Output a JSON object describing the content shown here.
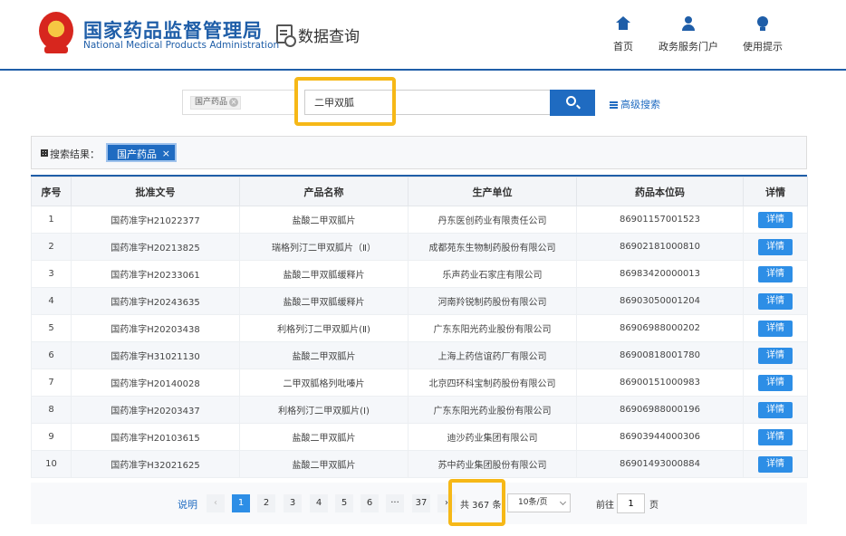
{
  "header": {
    "brand_cn": "国家药品监督管理局",
    "brand_en": "National Medical Products Administration",
    "query_title": "数据查询",
    "nav": [
      {
        "label": "首页",
        "icon": "home-icon"
      },
      {
        "label": "政务服务门户",
        "icon": "user-icon"
      },
      {
        "label": "使用提示",
        "icon": "lightbulb-icon"
      }
    ]
  },
  "search": {
    "scope_tag": "国产药品",
    "query": "二甲双胍",
    "advanced_label": "高级搜索"
  },
  "results": {
    "label": "搜索结果：",
    "chip": "国产药品",
    "chip_close": "×"
  },
  "table": {
    "headers": [
      "序号",
      "批准文号",
      "产品名称",
      "生产单位",
      "药品本位码",
      "详情"
    ],
    "detail_label": "详情",
    "rows": [
      [
        "1",
        "国药准字H21022377",
        "盐酸二甲双胍片",
        "丹东医创药业有限责任公司",
        "86901157001523"
      ],
      [
        "2",
        "国药准字H20213825",
        "瑞格列汀二甲双胍片（Ⅱ）",
        "成都苑东生物制药股份有限公司",
        "86902181000810"
      ],
      [
        "3",
        "国药准字H20233061",
        "盐酸二甲双胍缓释片",
        "乐声药业石家庄有限公司",
        "86983420000013"
      ],
      [
        "4",
        "国药准字H20243635",
        "盐酸二甲双胍缓释片",
        "河南羚锐制药股份有限公司",
        "86903050001204"
      ],
      [
        "5",
        "国药准字H20203438",
        "利格列汀二甲双胍片(Ⅱ)",
        "广东东阳光药业股份有限公司",
        "86906988000202"
      ],
      [
        "6",
        "国药准字H31021130",
        "盐酸二甲双胍片",
        "上海上药信谊药厂有限公司",
        "86900818001780"
      ],
      [
        "7",
        "国药准字H20140028",
        "二甲双胍格列吡嗪片",
        "北京四环科宝制药股份有限公司",
        "86900151000983"
      ],
      [
        "8",
        "国药准字H20203437",
        "利格列汀二甲双胍片(Ⅰ)",
        "广东东阳光药业股份有限公司",
        "86906988000196"
      ],
      [
        "9",
        "国药准字H20103615",
        "盐酸二甲双胍片",
        "迪沙药业集团有限公司",
        "86903944000306"
      ],
      [
        "10",
        "国药准字H32021625",
        "盐酸二甲双胍片",
        "苏中药业集团股份有限公司",
        "86901493000884"
      ]
    ]
  },
  "pagination": {
    "explain": "说明",
    "prev": "‹",
    "pages": [
      "1",
      "2",
      "3",
      "4",
      "5",
      "6",
      "···",
      "37"
    ],
    "next": "›",
    "current_page": "1",
    "total": "共 367 条",
    "page_size": "10条/页",
    "goto_label": "前往",
    "goto_value": "1",
    "goto_suffix": "页"
  },
  "colors": {
    "brand_blue": "#1f5ea8",
    "button_blue": "#2d8ee6",
    "highlight": "#f6b817"
  }
}
